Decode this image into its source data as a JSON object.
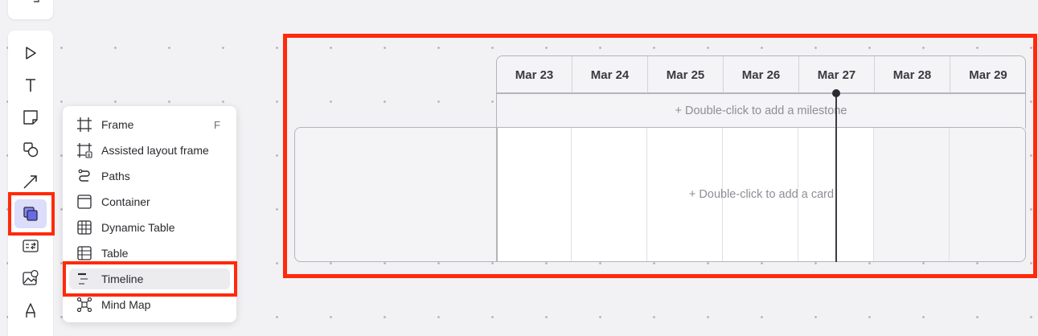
{
  "colors": {
    "accent": "#ff2a0a",
    "active_tool_bg": "#dcdcfb",
    "today_marker": "#2a2a30"
  },
  "toolbar": {
    "tools": [
      {
        "icon": "pointer-icon"
      },
      {
        "icon": "text-icon"
      },
      {
        "icon": "sticky-note-icon"
      },
      {
        "icon": "shapes-icon"
      },
      {
        "icon": "connector-line-icon"
      },
      {
        "icon": "frames-icon",
        "active": true
      },
      {
        "icon": "smart-diagram-icon"
      },
      {
        "icon": "image-icon"
      },
      {
        "icon": "pen-icon"
      }
    ]
  },
  "menu": {
    "items": [
      {
        "label": "Frame",
        "shortcut": "F",
        "icon": "frame-icon"
      },
      {
        "label": "Assisted layout frame",
        "shortcut": "",
        "icon": "assisted-layout-frame-icon"
      },
      {
        "label": "Paths",
        "shortcut": "",
        "icon": "paths-icon"
      },
      {
        "label": "Container",
        "shortcut": "",
        "icon": "container-icon"
      },
      {
        "label": "Dynamic Table",
        "shortcut": "",
        "icon": "dynamic-table-icon"
      },
      {
        "label": "Table",
        "shortcut": "",
        "icon": "table-icon"
      },
      {
        "label": "Timeline",
        "shortcut": "",
        "icon": "timeline-icon",
        "selected": true
      },
      {
        "label": "Mind Map",
        "shortcut": "",
        "icon": "mind-map-icon"
      }
    ]
  },
  "timeline": {
    "days": [
      "Mar 23",
      "Mar 24",
      "Mar 25",
      "Mar 26",
      "Mar 27",
      "Mar 28",
      "Mar 29"
    ],
    "milestone_hint": "+ Double-click to add a milestone",
    "card_hint": "+ Double-click to add a card"
  }
}
